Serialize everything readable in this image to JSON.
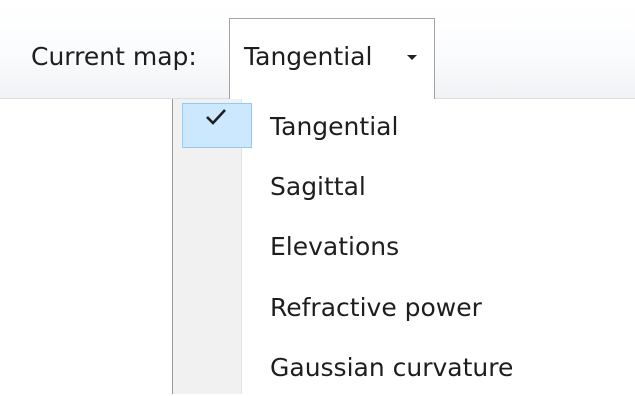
{
  "toolbar": {
    "current_map_label": "Current map:",
    "selected_value": "Tangential",
    "arrow_icon": "dropdown-arrow-icon"
  },
  "menu": {
    "items": [
      {
        "label": "Tangential",
        "checked": true
      },
      {
        "label": "Sagittal",
        "checked": false
      },
      {
        "label": "Elevations",
        "checked": false
      },
      {
        "label": "Refractive power",
        "checked": false
      },
      {
        "label": "Gaussian curvature",
        "checked": false
      }
    ],
    "check_icon": "checkmark-icon"
  },
  "colors": {
    "selection_fill": "#cce8ff",
    "selection_border": "#94c9f6",
    "gutter": "#f1f1f1",
    "border": "#a4a4a4"
  }
}
